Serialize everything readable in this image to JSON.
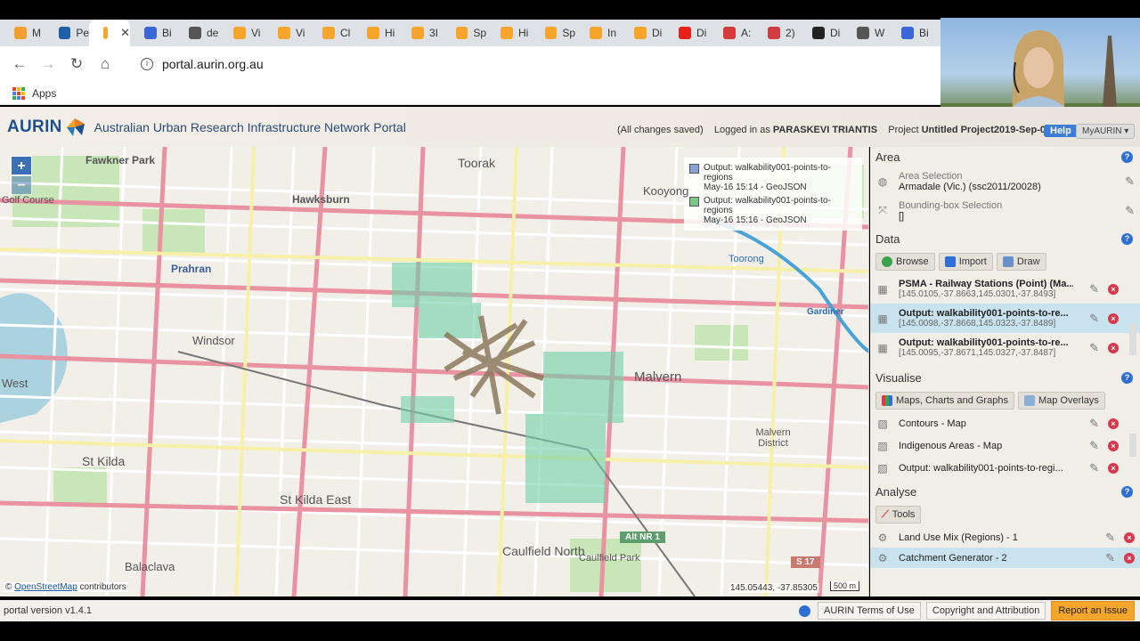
{
  "browser": {
    "tabs": [
      {
        "label": "M",
        "color": "#f0a030"
      },
      {
        "label": "Pe",
        "color": "#1f5fa8"
      },
      {
        "label": "",
        "color": "#f5a52b",
        "active": true
      },
      {
        "label": "Bi",
        "color": "#3b66d8"
      },
      {
        "label": "de",
        "color": "#555555"
      },
      {
        "label": "Vi",
        "color": "#f5a52b"
      },
      {
        "label": "Vi",
        "color": "#f5a52b"
      },
      {
        "label": "Cl",
        "color": "#f5a52b"
      },
      {
        "label": "Hi",
        "color": "#f5a52b"
      },
      {
        "label": "3I",
        "color": "#f5a52b"
      },
      {
        "label": "Sp",
        "color": "#f5a52b"
      },
      {
        "label": "Hi",
        "color": "#f5a52b"
      },
      {
        "label": "Sp",
        "color": "#f5a52b"
      },
      {
        "label": "In",
        "color": "#f5a52b"
      },
      {
        "label": "Di",
        "color": "#f5a52b"
      },
      {
        "label": "Di",
        "color": "#e62117"
      },
      {
        "label": "A:",
        "color": "#d23c3c"
      },
      {
        "label": "2)",
        "color": "#d23c3c"
      },
      {
        "label": "Di",
        "color": "#222222"
      },
      {
        "label": "W",
        "color": "#555555"
      },
      {
        "label": "Bi",
        "color": "#3b66d8"
      }
    ],
    "url": "portal.aurin.org.au",
    "bookmarks_apps": "Apps"
  },
  "header": {
    "logo": "AURIN",
    "title": "Australian Urban Research Infrastructure Network Portal",
    "saved_status": "(All changes saved)",
    "logged_in_prefix": "Logged in as",
    "user": "PARASKEVI TRIANTIS",
    "project_prefix": "Project",
    "project_name": "Untitled Project2019-Sep-03 15:55",
    "help": "Help",
    "myaurin": "MyAURIN ▾"
  },
  "map": {
    "zoom_in": "+",
    "zoom_out": "−",
    "legend": [
      {
        "label": "Output: walkability001-points-to-regions",
        "sub": "May-16 15:14 - GeoJSON",
        "color": "#8aa0d8"
      },
      {
        "label": "Output: walkability001-points-to-regions",
        "sub": "May-16 15:16 - GeoJSON",
        "color": "#7bc98a"
      }
    ],
    "labels": [
      "Fawkner Park",
      "Toorak",
      "Kooyong",
      "Hawksburn",
      "Prahran",
      "Windsor",
      "St Kilda",
      "St Kilda East",
      "Malvern",
      "Malvern District",
      "Caulfield North",
      "Caulfield Park",
      "Balaclava",
      "West",
      "Gardiner",
      "Toorong",
      "Alt NR 1",
      "S 17",
      "Golf Course"
    ],
    "coords": "145.05443, -37.85305",
    "scale": "500 m",
    "attribution_symbol": "©",
    "attribution_link": "OpenStreetMap",
    "attribution_suffix": "contributors"
  },
  "panel": {
    "area": {
      "title": "Area",
      "area_selection_label": "Area Selection",
      "area_selection_value": "Armadale (Vic.) (ssc2011/20028)",
      "bbox_label": "Bounding-box Selection",
      "bbox_value": "[]"
    },
    "data": {
      "title": "Data",
      "buttons": [
        "Browse",
        "Import",
        "Draw"
      ],
      "datasets": [
        {
          "title": "PSMA - Railway Stations (Point) (Ma...",
          "bbox": "[145.0105,-37.8663,145.0301,-37.8493]",
          "selected": false
        },
        {
          "title": "Output: walkability001-points-to-re...",
          "bbox": "[145.0098,-37.8668,145.0323,-37.8489]",
          "selected": true
        },
        {
          "title": "Output: walkability001-points-to-re...",
          "bbox": "[145.0095,-37.8671,145.0327,-37.8487]",
          "selected": false
        }
      ]
    },
    "visualise": {
      "title": "Visualise",
      "buttons": [
        "Maps, Charts and Graphs",
        "Map Overlays"
      ],
      "items": [
        "Contours - Map",
        "Indigenous Areas - Map",
        "Output: walkability001-points-to-regi..."
      ]
    },
    "analyse": {
      "title": "Analyse",
      "tools_button": "Tools",
      "items": [
        {
          "label": "Land Use Mix (Regions) - 1",
          "selected": false
        },
        {
          "label": "Catchment Generator - 2",
          "selected": true
        }
      ]
    }
  },
  "footer": {
    "version": "portal version v1.4.1",
    "terms": "AURIN Terms of Use",
    "copyright": "Copyright and Attribution",
    "report": "Report an Issue"
  }
}
